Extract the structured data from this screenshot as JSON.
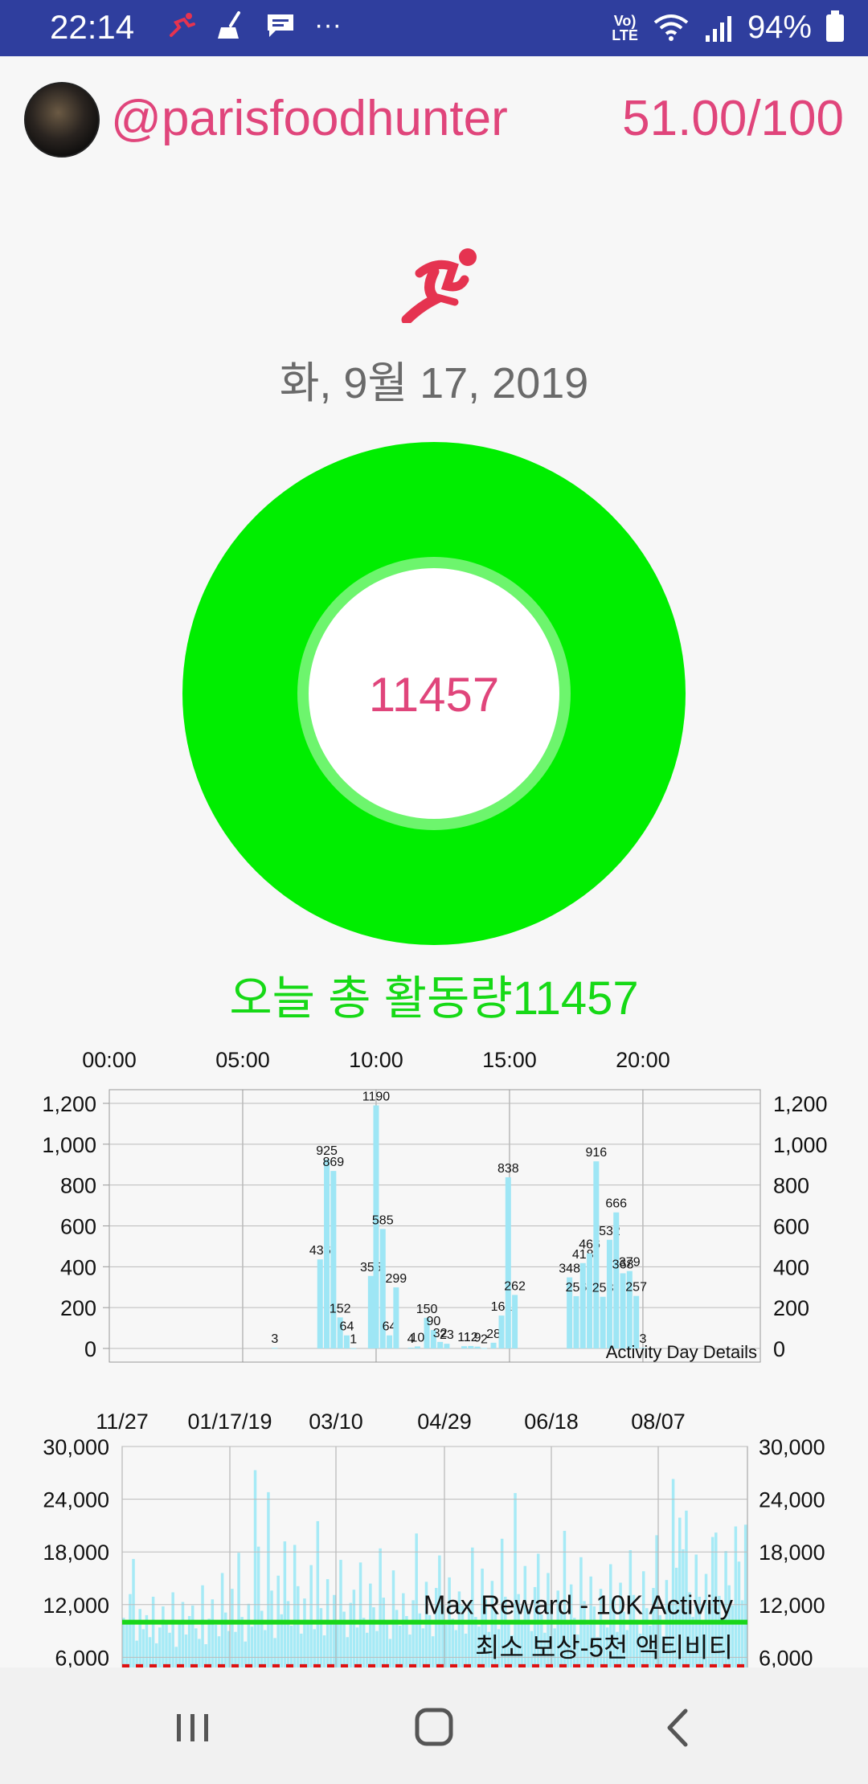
{
  "status_bar": {
    "time": "22:14",
    "signal_label": "Vo) LTE",
    "battery": "94%",
    "more": "···",
    "icons": [
      "runner-notification-icon",
      "broom-icon",
      "message-icon",
      "wifi-icon",
      "signal-icon",
      "battery-icon"
    ]
  },
  "header": {
    "username": "@parisfoodhunter",
    "score": "51.00/100",
    "accent_color": "#e0457b"
  },
  "date": "화, 9월 17, 2019",
  "donut": {
    "value": "11457",
    "colors": {
      "outer": "#00ee00",
      "inner_ring": "#6df56d",
      "center": "#ffffff"
    }
  },
  "today_total": "오늘 총 활동량11457",
  "chart_data": [
    {
      "type": "bar",
      "x_tick_labels": [
        "00:00",
        "05:00",
        "10:00",
        "15:00",
        "20:00"
      ],
      "y_tick_labels": [
        "1,200",
        "1,000",
        "800",
        "600",
        "400",
        "200",
        "0"
      ],
      "ylim": [
        0,
        1200
      ],
      "xlim": [
        0,
        24
      ],
      "annotation": "Activity Day Details",
      "bar_color": "#9ee6f5",
      "grid": true,
      "bars": [
        {
          "x": 6.2,
          "value": 3,
          "label": "3"
        },
        {
          "x": 7.9,
          "value": 436,
          "label": "436"
        },
        {
          "x": 8.15,
          "value": 925,
          "label": "925"
        },
        {
          "x": 8.4,
          "value": 869,
          "label": "869"
        },
        {
          "x": 8.65,
          "value": 152,
          "label": "152"
        },
        {
          "x": 8.9,
          "value": 64,
          "label": "64"
        },
        {
          "x": 9.15,
          "value": 1,
          "label": "1"
        },
        {
          "x": 9.8,
          "value": 355,
          "label": "355"
        },
        {
          "x": 10.0,
          "value": 1190,
          "label": "1190"
        },
        {
          "x": 10.25,
          "value": 585,
          "label": "585"
        },
        {
          "x": 10.5,
          "value": 64,
          "label": "64"
        },
        {
          "x": 10.75,
          "value": 299,
          "label": "299"
        },
        {
          "x": 11.3,
          "value": 4,
          "label": "4"
        },
        {
          "x": 11.55,
          "value": 10,
          "label": "10"
        },
        {
          "x": 11.9,
          "value": 150,
          "label": "150"
        },
        {
          "x": 12.15,
          "value": 90,
          "label": "90"
        },
        {
          "x": 12.4,
          "value": 32,
          "label": "32"
        },
        {
          "x": 12.65,
          "value": 23,
          "label": "23"
        },
        {
          "x": 13.3,
          "value": 11,
          "label": "11"
        },
        {
          "x": 13.55,
          "value": 12,
          "label": "12"
        },
        {
          "x": 13.8,
          "value": 9,
          "label": "9"
        },
        {
          "x": 14.05,
          "value": 2,
          "label": "2"
        },
        {
          "x": 14.4,
          "value": 28,
          "label": "28"
        },
        {
          "x": 14.7,
          "value": 161,
          "label": "161"
        },
        {
          "x": 14.95,
          "value": 838,
          "label": "838"
        },
        {
          "x": 15.2,
          "value": 262,
          "label": "262"
        },
        {
          "x": 17.25,
          "value": 348,
          "label": "348"
        },
        {
          "x": 17.5,
          "value": 256,
          "label": "256"
        },
        {
          "x": 17.75,
          "value": 418,
          "label": "418"
        },
        {
          "x": 18.0,
          "value": 466,
          "label": "466"
        },
        {
          "x": 18.25,
          "value": 916,
          "label": "916"
        },
        {
          "x": 18.5,
          "value": 253,
          "label": "253"
        },
        {
          "x": 18.75,
          "value": 532,
          "label": "532"
        },
        {
          "x": 19.0,
          "value": 666,
          "label": "666"
        },
        {
          "x": 19.25,
          "value": 368,
          "label": "368"
        },
        {
          "x": 19.5,
          "value": 379,
          "label": "379"
        },
        {
          "x": 19.75,
          "value": 257,
          "label": "257"
        },
        {
          "x": 20.0,
          "value": 3,
          "label": "3"
        }
      ]
    },
    {
      "type": "bar",
      "x_tick_labels": [
        "11/27",
        "01/17/19",
        "03/10",
        "04/29",
        "06/18",
        "08/07"
      ],
      "y_tick_labels": [
        "30,000",
        "24,000",
        "18,000",
        "12,000",
        "6,000"
      ],
      "ylim": [
        0,
        30000
      ],
      "bar_color": "#a6eaf6",
      "grid": true,
      "reference_lines": [
        {
          "value": 10000,
          "label": "Max Reward - 10K Activity",
          "color": "#1ad61a",
          "style": "solid"
        },
        {
          "value": 5000,
          "label": "최소 보상-5천 액티비티",
          "color": "#dd1111",
          "style": "dashed"
        }
      ],
      "values": [
        10500,
        9800,
        13200,
        17200,
        7900,
        11500,
        9200,
        10800,
        8300,
        12900,
        7600,
        9400,
        11800,
        10200,
        8800,
        13400,
        7200,
        9900,
        12300,
        8600,
        10700,
        11900,
        9300,
        8100,
        14200,
        7500,
        10400,
        12600,
        9700,
        8400,
        15600,
        11100,
        9000,
        13800,
        8900,
        17900,
        10600,
        7800,
        12100,
        9500,
        27300,
        18600,
        11300,
        9100,
        24800,
        13600,
        8200,
        15300,
        10900,
        19200,
        12400,
        9600,
        18800,
        14100,
        8700,
        12700,
        10300,
        16500,
        9200,
        21500,
        11600,
        8500,
        14900,
        10100,
        13100,
        9800,
        17100,
        11200,
        8300,
        12200,
        13700,
        9400,
        16800,
        10500,
        8800,
        14400,
        11700,
        9000,
        18400,
        12800,
        10200,
        8100,
        15900,
        11400,
        9600,
        13300,
        10700,
        8600,
        12500,
        20100,
        11000,
        9300,
        14600,
        10800,
        8400,
        13900,
        17600,
        12000,
        9700,
        15100,
        10400,
        9100,
        13500,
        11900,
        8700,
        12300,
        18500,
        10600,
        9500,
        16100,
        12600,
        8900,
        14700,
        11300,
        9200,
        19500,
        12900,
        10100,
        8500,
        24700,
        13200,
        9800,
        16400,
        11500,
        9000,
        14000,
        17800,
        10900,
        8800,
        15600,
        12100,
        9300,
        13600,
        11100,
        20400,
        9900,
        14300,
        10500,
        8600,
        17400,
        12400,
        9700,
        15200,
        11800,
        8300,
        13800,
        10000,
        9400,
        16600,
        12700,
        8900,
        14500,
        11200,
        9100,
        18200,
        13100,
        10300,
        8700,
        15800,
        11600,
        9600,
        13900,
        19900,
        10800,
        8400,
        14800,
        12200,
        26300,
        16200,
        21900,
        18300,
        22700,
        13400,
        10600,
        17700,
        12900,
        9800,
        15500,
        11700,
        19700,
        20200,
        13000,
        10400,
        18100,
        14200,
        11900,
        20900,
        16900,
        12500,
        21100
      ]
    }
  ],
  "nav": {
    "recent_apps": "recent-apps-icon",
    "home": "home-icon",
    "back": "back-icon"
  }
}
